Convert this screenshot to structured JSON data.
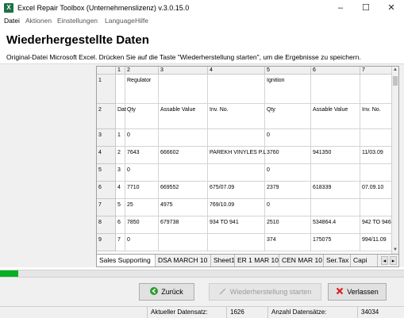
{
  "window": {
    "title": "Excel Repair Toolbox (Unternehmenslizenz) v.3.0.15.0",
    "icon_letter": "X",
    "controls": [
      "–",
      "☐",
      "✕"
    ]
  },
  "menu": [
    "Datei",
    "Aktionen",
    "Einstellungen",
    "Language",
    "Hilfe"
  ],
  "header": {
    "title": "Wiederhergestellte Daten",
    "subtitle": "Original-Datei Microsoft Excel. Drücken Sie auf die Taste \"Wiederherstellung starten\", um die Ergebnisse zu speichern."
  },
  "sheet": {
    "column_headers": [
      "1",
      "2",
      "3",
      "4",
      "5",
      "6",
      "7"
    ],
    "row_headers": [
      "1",
      "2",
      "3",
      "4",
      "5",
      "6",
      "7",
      "8",
      "9"
    ],
    "rows": [
      [
        "",
        "Regulator",
        "",
        "",
        "Ignition",
        "",
        ""
      ],
      [
        "Dat",
        "Qty",
        "Assable Value",
        "Inv. No.",
        "Qty",
        "Assable Value",
        "Inv. No."
      ],
      [
        "1",
        "0",
        "",
        "",
        "0",
        "",
        ""
      ],
      [
        "2",
        "7643",
        "666602",
        "PAREKH VINYLES P.L",
        "3760",
        "941350",
        "11/03.09"
      ],
      [
        "3",
        "0",
        "",
        "",
        "0",
        "",
        ""
      ],
      [
        "4",
        "7710",
        "669552",
        "675/07.09",
        "2379",
        "618339",
        "07.09.10"
      ],
      [
        "5",
        "25",
        "4975",
        "769/10.09",
        "0",
        "",
        ""
      ],
      [
        "6",
        "7850",
        "679738",
        "934 TO 941",
        "2510",
        "534864.4",
        "942 TO 946"
      ],
      [
        "7",
        "0",
        "",
        "",
        "374",
        "175075",
        "994/11.09"
      ]
    ],
    "tabs": [
      "Sales Supporting",
      "DSA MARCH 10",
      "Sheet1",
      "ER 1 MAR 10",
      "CEN MAR 10",
      "Ser.Tax",
      "Capi"
    ],
    "tab_nav": [
      "◂",
      "▸"
    ],
    "scroll_arrows": [
      "▲",
      "▼"
    ]
  },
  "progress": {
    "fraction": 0.045
  },
  "buttons": {
    "back": "Zurück",
    "start": "Wiederherstellung starten",
    "exit": "Verlassen"
  },
  "status": {
    "current_label": "Aktueller Datensatz:",
    "current_value": "1626",
    "count_label": "Anzahl Datensätze:",
    "count_value": "34034"
  },
  "colors": {
    "excel_green": "#1e7145",
    "progress_green": "#06b025",
    "exit_red": "#d9211e",
    "back_green": "#2d9b2f"
  }
}
